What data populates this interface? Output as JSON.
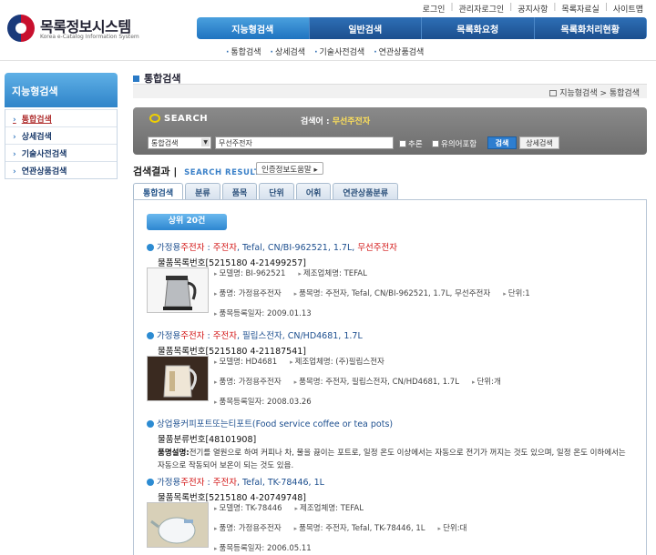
{
  "header": {
    "logo_title": "목록정보시스템",
    "logo_subtitle": "Korea e-Catalog Information System",
    "top_links": [
      "로그인",
      "관리자로그인",
      "공지사항",
      "목록자료실",
      "사이트맵"
    ],
    "main_nav": [
      "지능형검색",
      "일반검색",
      "목록화요청",
      "목록화처리현황"
    ],
    "sub_nav": [
      "통합검색",
      "상세검색",
      "기술사전검색",
      "연관상품검색"
    ]
  },
  "sidebar": {
    "title": "지능형검색",
    "items": [
      "통합검색",
      "상세검색",
      "기술사전검색",
      "연관상품검색"
    ]
  },
  "page": {
    "title": "통합검색",
    "breadcrumb": "지능형검색 > 통합검색"
  },
  "search": {
    "logo": "SEARCH",
    "term_label": "검색어 :",
    "term": "무선주전자",
    "scope": "통합검색",
    "query": "무선주전자",
    "opt_infer": "추론",
    "opt_synonym": "유의어포함",
    "btn_search": "검색",
    "btn_detail": "상세검색"
  },
  "results": {
    "heading": "검색결과",
    "heading_en": "SEARCH RESULT",
    "portal_button": "인증정보도움말 ▸",
    "tabs": [
      "통합검색",
      "분류",
      "품목",
      "단위",
      "어휘",
      "연관상품분류"
    ],
    "count_label": "상위 20건",
    "items": [
      {
        "title_prefix": "가정용",
        "title_red1": "주전자",
        "title_mid": " : ",
        "title_red2": "주전자",
        "title_rest": ", Tefal, CN/BI-962521, 1.7L, ",
        "title_red3": "무선주전자",
        "code": "물품목록번호[5215180 4-21499257]",
        "model": "모델명: BI-962521",
        "maker": "제조업체명: TEFAL",
        "category": "품명: 가정용주전자",
        "name": "품목명: 주전자, Tefal, CN/BI-962521, 1.7L, 무선주전자",
        "unit": "단위:1",
        "date": "품목등록일자: 2009.01.13"
      },
      {
        "title_prefix": "가정용",
        "title_red1": "주전자",
        "title_mid": " : ",
        "title_red2": "주전자",
        "title_rest": ", 필립스전자, CN/HD4681, 1.7L",
        "title_red3": "",
        "code": "물품목록번호[5215180 4-21187541]",
        "model": "모델명: HD4681",
        "maker": "제조업체명: (주)필립스전자",
        "category": "품명: 가정용주전자",
        "name": "품목명: 주전자, 필립스전자, CN/HD4681, 1.7L",
        "unit": "단위:개",
        "date": "품목등록일자: 2008.03.26"
      },
      {
        "title": "상업용커피포트또는티포트(Food service coffee or tea pots)",
        "code": "물품분류번호[48101908]",
        "desc_label": "품명설명:",
        "desc": "전기를 열원으로 하여 커피나 차, 물을 끓이는 포트로, 일정 온도 이상에서는 자동으로 전기가 꺼지는 것도 있으며, 일정 온도 이하에서는 자동으로 작동되어 보온이 되는 것도 있음."
      },
      {
        "title_prefix": "가정용",
        "title_red1": "주전자",
        "title_mid": " : ",
        "title_red2": "주전자",
        "title_rest": ", Tefal, TK-78446, 1L",
        "title_red3": "",
        "code": "물품목록번호[5215180 4-20749748]",
        "model": "모델명: TK-78446",
        "maker": "제조업체명: TEFAL",
        "category": "품명: 가정용주전자",
        "name": "품목명: 주전자, Tefal, TK-78446, 1L",
        "unit": "단위:대",
        "date": "품목등록일자: 2006.05.11"
      }
    ]
  }
}
